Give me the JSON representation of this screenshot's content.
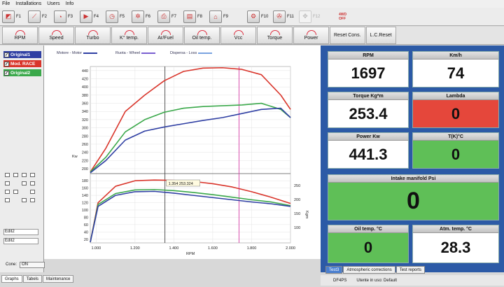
{
  "menu": [
    "File",
    "Installations",
    "Users",
    "Info"
  ],
  "toolbar": [
    {
      "key": "F1",
      "icon": "dyno-icon"
    },
    {
      "key": "F2",
      "icon": "graph-icon"
    },
    {
      "key": "F3",
      "icon": "gauge-icon"
    },
    {
      "key": "F4",
      "icon": "play-icon"
    },
    {
      "key": "F5",
      "icon": "timer-icon"
    },
    {
      "key": "F6",
      "icon": "wheel-icon"
    },
    {
      "key": "F7",
      "icon": "print-icon"
    },
    {
      "key": "F8",
      "icon": "export-icon"
    },
    {
      "key": "F9",
      "icon": "remote-icon"
    },
    {
      "key": "F10",
      "icon": "settings-icon"
    },
    {
      "key": "F11",
      "icon": "fan-icon"
    },
    {
      "key": "F12",
      "icon": "engine-icon"
    }
  ],
  "toolbar_status": [
    "4WD",
    "OFF"
  ],
  "gauge_tabs": [
    "RPM",
    "Speed",
    "Turbo",
    "K° temp.",
    "Ar/Fuel",
    "Oil temp.",
    "Vcc",
    "Torque",
    "Power"
  ],
  "reset_buttons": [
    "Reset Cons.",
    "L.C.Reset"
  ],
  "legend": [
    {
      "label": "Original1",
      "color": "#2f3fa3",
      "checked": true
    },
    {
      "label": "Mod. RACE",
      "color": "#d9352b",
      "checked": true
    },
    {
      "label": "Original2",
      "color": "#3aa84a",
      "checked": true
    }
  ],
  "slots": [
    "Edit2",
    "Edit2"
  ],
  "cone": {
    "label": "Cone:",
    "value": "ON"
  },
  "bottom_tabs": [
    "Graphs",
    "Tabels",
    "Maintenance"
  ],
  "chart_data": {
    "type": "line",
    "legend": [
      {
        "name": "Motore - Motor",
        "color": "#2f3fa3"
      },
      {
        "name": "Ruota - Wheel",
        "color": "#7a5fd0"
      },
      {
        "name": "Dispersa - Loss",
        "color": "#7aa3e0"
      }
    ],
    "xlabel": "RPM",
    "ylabel_left_upper": "Kw",
    "ylabel_right_lower": "Kgm",
    "x_ticks": [
      "1.000",
      "1.200",
      "1.400",
      "1.600",
      "1.800",
      "2.000"
    ],
    "xlim": [
      970,
      2000
    ],
    "y_ticks_upper": [
      "200",
      "220",
      "240",
      "260",
      "280",
      "300",
      "320",
      "340",
      "360",
      "380",
      "400",
      "420",
      "440"
    ],
    "y_ticks_lower": [
      "20",
      "40",
      "60",
      "80",
      "100",
      "120",
      "140",
      "160",
      "180"
    ],
    "y_ticks_right": [
      "100",
      "150",
      "200",
      "250"
    ],
    "ylim_upper": [
      188,
      450
    ],
    "ylim_lower": [
      10,
      190
    ],
    "cursor_label": "1.354 253.324",
    "cursor_x": 1354,
    "marker_x": 1735,
    "power_series": [
      {
        "name": "Mod. RACE",
        "color": "#d9352b",
        "x": [
          970,
          1050,
          1150,
          1250,
          1350,
          1450,
          1550,
          1650,
          1750,
          1850,
          1950,
          2000
        ],
        "y": [
          192,
          250,
          340,
          380,
          415,
          438,
          446,
          447,
          443,
          430,
          380,
          345
        ]
      },
      {
        "name": "Original2",
        "color": "#3aa84a",
        "x": [
          970,
          1050,
          1150,
          1250,
          1350,
          1450,
          1550,
          1650,
          1750,
          1850,
          1950,
          2000
        ],
        "y": [
          192,
          228,
          290,
          320,
          338,
          348,
          352,
          354,
          356,
          360,
          345,
          325
        ]
      },
      {
        "name": "Original1",
        "color": "#2f3fa3",
        "x": [
          970,
          1050,
          1150,
          1250,
          1350,
          1450,
          1550,
          1650,
          1750,
          1850,
          1950,
          2000
        ],
        "y": [
          190,
          220,
          270,
          292,
          302,
          310,
          318,
          325,
          335,
          345,
          348,
          325
        ]
      }
    ],
    "torque_series": [
      {
        "name": "Mod. RACE",
        "color": "#d9352b",
        "x": [
          970,
          1010,
          1100,
          1200,
          1300,
          1400,
          1500,
          1600,
          1700,
          1800,
          1900,
          2000
        ],
        "y": [
          12,
          120,
          165,
          180,
          182,
          181,
          178,
          172,
          163,
          150,
          135,
          118
        ]
      },
      {
        "name": "Original2",
        "color": "#3aa84a",
        "x": [
          970,
          1010,
          1100,
          1200,
          1300,
          1400,
          1500,
          1600,
          1700,
          1800,
          1900,
          2000
        ],
        "y": [
          12,
          115,
          145,
          155,
          156,
          153,
          148,
          142,
          135,
          128,
          122,
          112
        ]
      },
      {
        "name": "Original1",
        "color": "#2f3fa3",
        "x": [
          970,
          1010,
          1100,
          1200,
          1300,
          1400,
          1500,
          1600,
          1700,
          1800,
          1900,
          2000
        ],
        "y": [
          12,
          110,
          140,
          150,
          151,
          146,
          140,
          134,
          128,
          122,
          117,
          110
        ]
      }
    ]
  },
  "readouts": [
    {
      "id": "rpm",
      "label": "RPM",
      "value": "1697",
      "state": "normal"
    },
    {
      "id": "kmh",
      "label": "Km/h",
      "value": "74",
      "state": "normal"
    },
    {
      "id": "torque",
      "label": "Torque Kg*m",
      "value": "253.4",
      "state": "normal"
    },
    {
      "id": "lambda",
      "label": "Lambda",
      "value": "0",
      "state": "red"
    },
    {
      "id": "power",
      "label": "Power Kw",
      "value": "441.3",
      "state": "normal"
    },
    {
      "id": "tk",
      "label": "T(K)°C",
      "value": "0",
      "state": "green"
    },
    {
      "id": "intake",
      "label": "Intake manifold Psi",
      "value": "0",
      "state": "green"
    },
    {
      "id": "oiltemp",
      "label": "Oil temp. °C",
      "value": "0",
      "state": "green"
    },
    {
      "id": "atmtemp",
      "label": "Atm. temp. °C",
      "value": "28.3",
      "state": "normal"
    }
  ],
  "right_tabs": [
    "Test3",
    "Atmospheric corrections",
    "Test reports"
  ],
  "status": {
    "left": "DF4PS",
    "user": "Utente in uso: Default"
  }
}
